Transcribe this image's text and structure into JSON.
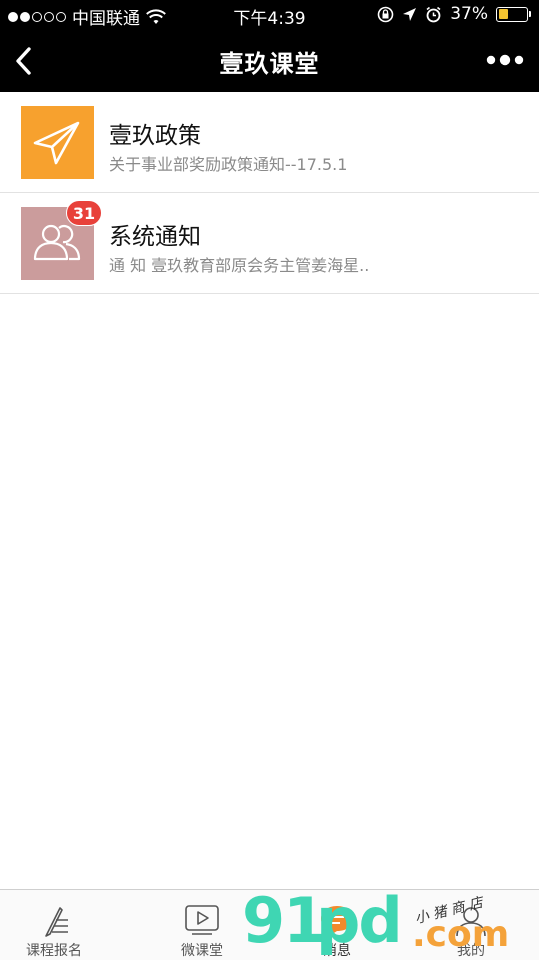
{
  "status_bar": {
    "carrier": "中国联通",
    "time": "下午4:39",
    "battery_percent": "37%",
    "battery_level": 0.37,
    "signal_strength": 2,
    "signal_max": 5
  },
  "nav": {
    "title": "壹玖课堂"
  },
  "messages": [
    {
      "title": "壹玖政策",
      "subtitle": "关于事业部奖励政策通知--17.5.1",
      "icon": "paper-plane-icon",
      "icon_color": "#f7a12e"
    },
    {
      "title": "系统通知",
      "subtitle": "通 知 壹玖教育部原会务主管姜海星..",
      "icon": "users-icon",
      "icon_color": "#cb9c9c",
      "badge": "31"
    }
  ],
  "tabs": [
    {
      "label": "课程报名",
      "icon": "pen-list-icon"
    },
    {
      "label": "微课堂",
      "icon": "video-play-icon"
    },
    {
      "label": "消息",
      "icon": "chat-bubble-icon",
      "active": true
    },
    {
      "label": "我的",
      "icon": "person-icon"
    }
  ],
  "watermark": {
    "logo_number": "91",
    "logo_letters": "pd",
    "logo_domain": ".com",
    "tagline": "小 猪 商 店"
  },
  "colors": {
    "nav_bg": "#000000",
    "orange_icon": "#f7a12e",
    "pink_icon": "#cb9c9c",
    "badge": "#e8413a",
    "battery_fill": "#f4c430",
    "watermark_green": "#3fd6b3",
    "watermark_orange": "#f4a23a"
  }
}
